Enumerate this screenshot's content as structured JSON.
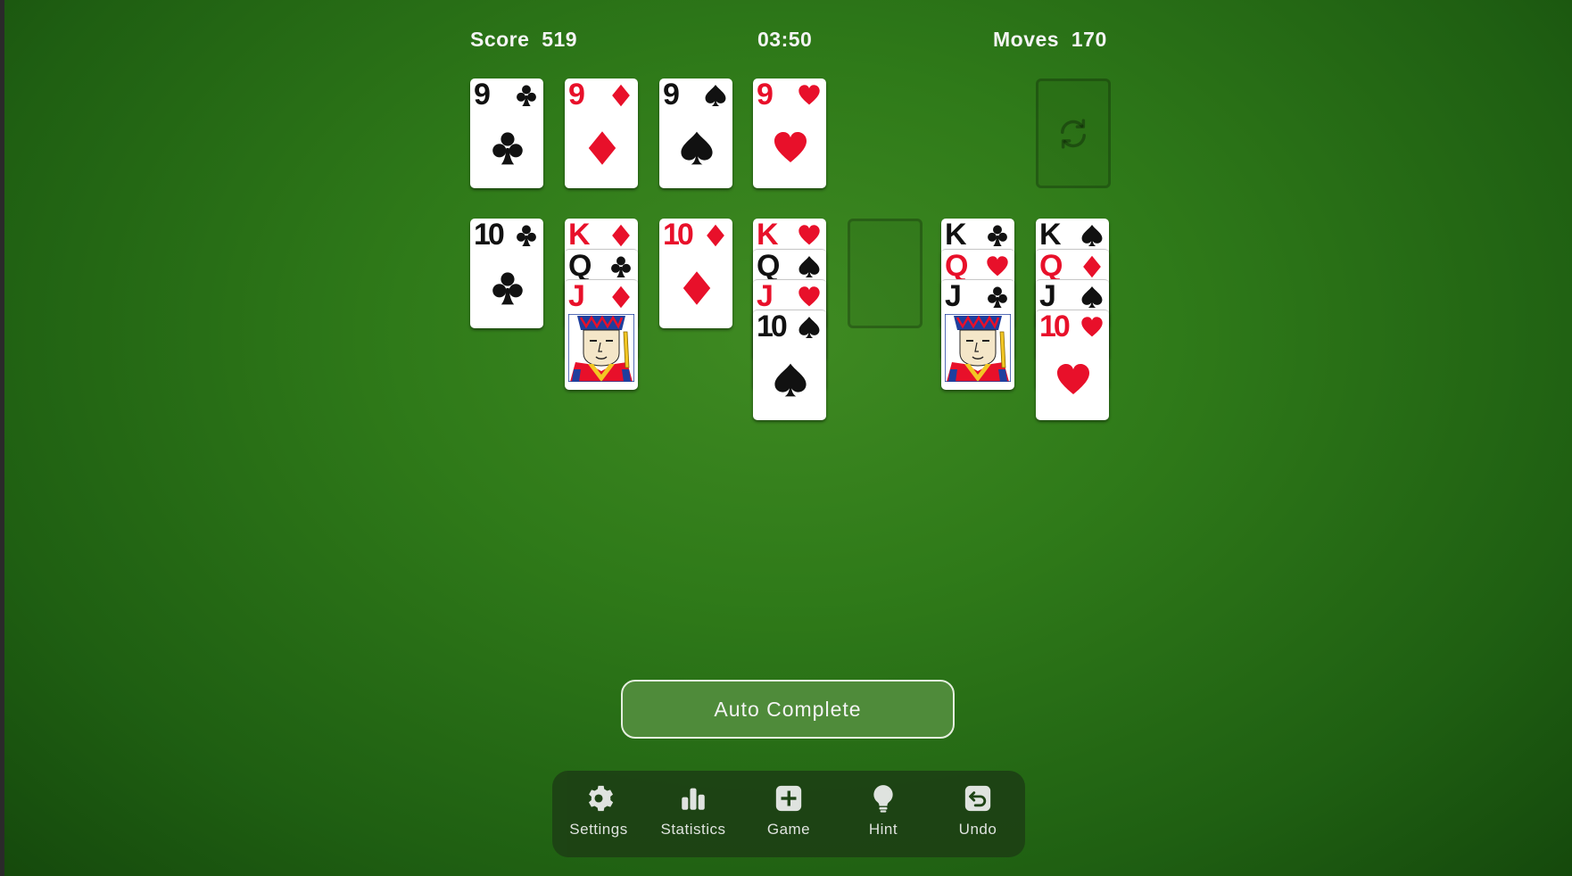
{
  "header": {
    "score_label": "Score",
    "score_value": "519",
    "timer": "03:50",
    "moves_label": "Moves",
    "moves_value": "170"
  },
  "foundations": [
    {
      "rank": "9",
      "suit": "clubs",
      "color": "black"
    },
    {
      "rank": "9",
      "suit": "diamonds",
      "color": "red"
    },
    {
      "rank": "9",
      "suit": "spades",
      "color": "black"
    },
    {
      "rank": "9",
      "suit": "hearts",
      "color": "red"
    }
  ],
  "stock": {
    "state": "empty",
    "icon": "recycle-icon"
  },
  "tableau": [
    [
      {
        "rank": "10",
        "suit": "clubs",
        "color": "black"
      }
    ],
    [
      {
        "rank": "K",
        "suit": "diamonds",
        "color": "red"
      },
      {
        "rank": "Q",
        "suit": "clubs",
        "color": "black"
      },
      {
        "rank": "J",
        "suit": "diamonds",
        "color": "red"
      }
    ],
    [
      {
        "rank": "10",
        "suit": "diamonds",
        "color": "red"
      }
    ],
    [
      {
        "rank": "K",
        "suit": "hearts",
        "color": "red"
      },
      {
        "rank": "Q",
        "suit": "spades",
        "color": "black"
      },
      {
        "rank": "J",
        "suit": "hearts",
        "color": "red"
      },
      {
        "rank": "10",
        "suit": "spades",
        "color": "black"
      }
    ],
    [],
    [
      {
        "rank": "K",
        "suit": "clubs",
        "color": "black"
      },
      {
        "rank": "Q",
        "suit": "hearts",
        "color": "red"
      },
      {
        "rank": "J",
        "suit": "clubs",
        "color": "black"
      }
    ],
    [
      {
        "rank": "K",
        "suit": "spades",
        "color": "black"
      },
      {
        "rank": "Q",
        "suit": "diamonds",
        "color": "red"
      },
      {
        "rank": "J",
        "suit": "spades",
        "color": "black"
      },
      {
        "rank": "10",
        "suit": "hearts",
        "color": "red"
      }
    ]
  ],
  "auto_complete_label": "Auto Complete",
  "toolbar": {
    "settings": "Settings",
    "statistics": "Statistics",
    "game": "Game",
    "hint": "Hint",
    "undo": "Undo"
  },
  "colors": {
    "felt": "#2f7a19",
    "red_suit": "#e8102a",
    "black_suit": "#111111",
    "toolbar_bg": "#1d4214",
    "button_bg": "#4f8b3a"
  }
}
